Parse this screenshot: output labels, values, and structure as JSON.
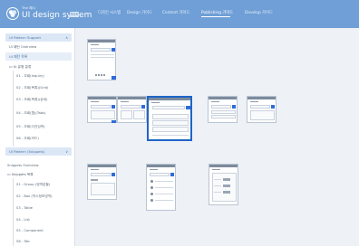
{
  "brand": {
    "small": "The 예시",
    "title": "UI design system",
    "badge": "가이드"
  },
  "nav": [
    "디자인 시스템",
    "Design 가이드",
    "Content 가이드",
    "Publishing 가이드",
    "Develop 가이드"
  ],
  "nav_active_index": 3,
  "sidebar": {
    "group1": "UI Pattern Support",
    "group1_chevron": "∧",
    "item_overview": "UI 패턴 Overview",
    "item_templates": "UI 패턴 목록",
    "folder_label": "UI 유형 분류",
    "subitems": [
      "01 - 조회(Inquiry)",
      "02 - 조회(목록)(Grid)",
      "03 - 조회(목록)(상세)",
      "04 - 조회(탭)(Tabs)",
      "05 - 조회(다건입력)",
      "06 - 조회(카드)"
    ],
    "group2": "UI Pattern (Snippets)",
    "group2_chevron": "∨",
    "item_snippets_overview": "Snippets Overview",
    "snippets_folder": "Snippets 목록",
    "snippets_items": [
      "S1 - Group (영역분할)",
      "S2 - Box (박스정보영역)",
      "S3 - Table",
      "S4 - List",
      "S5 - Component"
    ],
    "more": "S6 - Tab"
  },
  "thumbs": {
    "selected_index": 2,
    "rows": [
      [
        "regular"
      ],
      [
        "regular",
        "regular",
        "selected",
        "regular",
        "regular"
      ],
      [
        "regular",
        "list",
        "grid",
        "grid"
      ]
    ]
  }
}
